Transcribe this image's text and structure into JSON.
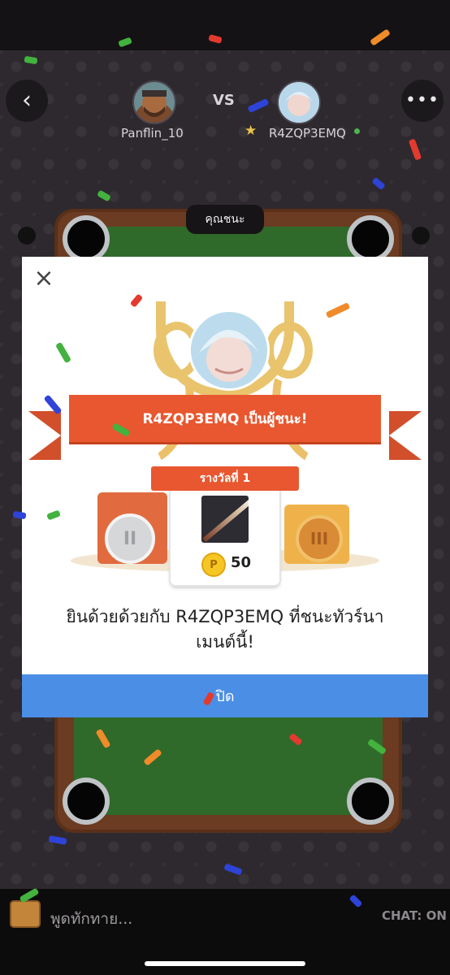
{
  "header": {
    "player1": {
      "name": "Panflin_10"
    },
    "vs_label": "VS",
    "player2": {
      "name": "R4ZQP3EMQ"
    }
  },
  "table": {
    "win_label": "คุณชนะ"
  },
  "modal": {
    "banner_text": "R4ZQP3EMQ เป็นผู้ชนะ!",
    "rank_label": "รางวัลที่ 1",
    "prize": {
      "coin_symbol": "P",
      "amount": "50"
    },
    "medal_silver": "II",
    "medal_bronze": "III",
    "congrats_line1": "ยินด้วยด้วยกับ R4ZQP3EMQ ที่ชนะทัวร์นา",
    "congrats_line2": "เมนต์นี้!",
    "close_button": "ปิด",
    "close_icon": "×"
  },
  "chat": {
    "placeholder": "พูดทักทาย...",
    "toggle": "CHAT: ON"
  },
  "icons": {
    "back": "‹",
    "more": "•••",
    "star": "★"
  },
  "colors": {
    "accent_orange": "#e8572f",
    "button_blue": "#4a8ee6",
    "felt_green": "#2f6a2b"
  }
}
